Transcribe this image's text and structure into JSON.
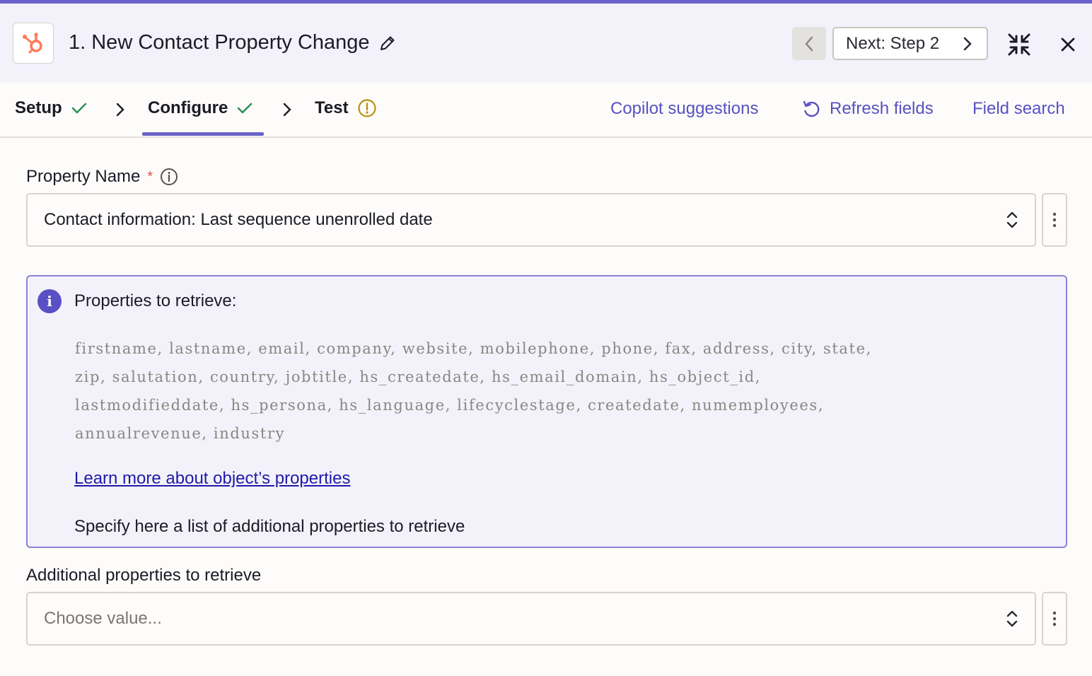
{
  "header": {
    "step_title": "1. New Contact Property Change",
    "next_label": "Next: Step 2"
  },
  "tabs": [
    {
      "label": "Setup",
      "status": "complete"
    },
    {
      "label": "Configure",
      "status": "complete"
    },
    {
      "label": "Test",
      "status": "warning"
    }
  ],
  "actions": {
    "copilot": "Copilot suggestions",
    "refresh": "Refresh fields",
    "field_search": "Field search"
  },
  "property_name": {
    "label": "Property Name",
    "required": "*",
    "value": "Contact information: Last sequence unenrolled date"
  },
  "info": {
    "title": "Properties to retrieve:",
    "properties_lines": [
      "firstname, lastname, email, company, website, mobilephone, phone, fax, address, city, state,",
      "zip, salutation, country, jobtitle, hs_createdate, hs_email_domain, hs_object_id,",
      "lastmodifieddate, hs_persona, hs_language, lifecyclestage, createdate, numemployees,",
      "annualrevenue, industry"
    ],
    "link": "Learn more about object’s properties",
    "description": "Specify here a list of additional properties to retrieve"
  },
  "additional": {
    "label": "Additional properties to retrieve",
    "placeholder": "Choose value..."
  },
  "colors": {
    "accent": "#6b63c9",
    "link": "#5a50c0",
    "success": "#2f8f5b",
    "warning": "#b8940f",
    "hubspot": "#ff7a59"
  }
}
